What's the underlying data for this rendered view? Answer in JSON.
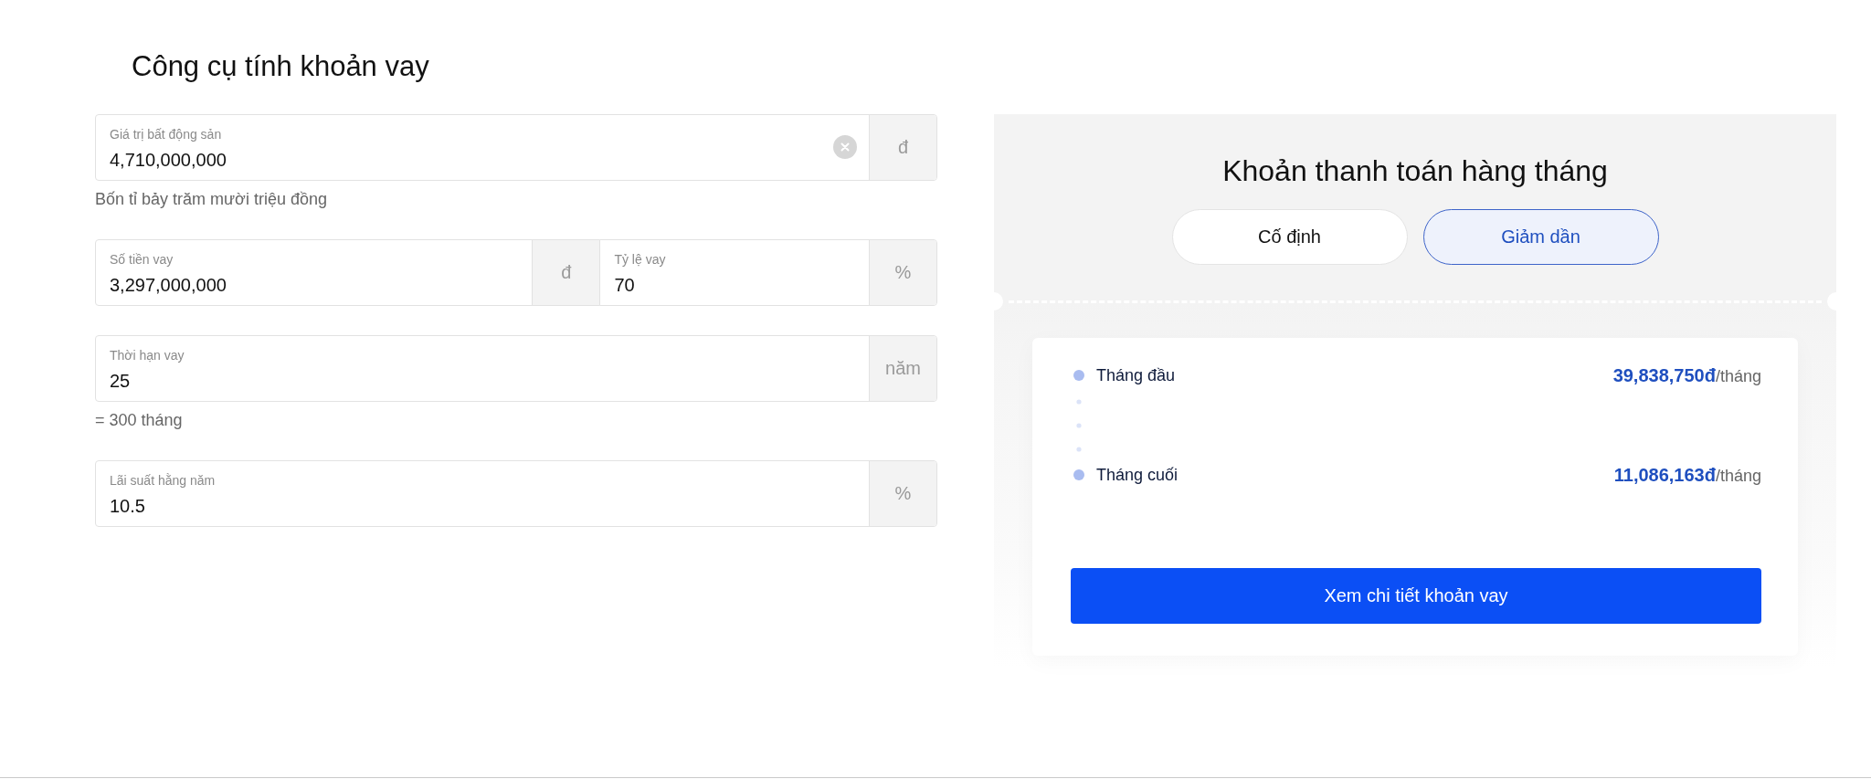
{
  "title": "Công cụ tính khoản vay",
  "form": {
    "groups": [
      {
        "fields": [
          {
            "label": "Giá trị bất động sản",
            "value": "4,710,000,000",
            "clearable": true,
            "unit": "đ"
          }
        ],
        "hint": "Bốn tỉ bảy trăm mười triệu đồng"
      },
      {
        "fields": [
          {
            "label": "Số tiền vay",
            "value": "3,297,000,000",
            "clearable": false,
            "unit": "đ"
          },
          {
            "label": "Tỷ lệ vay",
            "value": "70",
            "clearable": false,
            "unit": "%"
          }
        ]
      },
      {
        "fields": [
          {
            "label": "Thời hạn vay",
            "value": "25",
            "clearable": false,
            "unit": "năm"
          }
        ],
        "hint": "= 300 tháng"
      },
      {
        "fields": [
          {
            "label": "Lãi suất hằng năm",
            "value": "10.5",
            "clearable": false,
            "unit": "%"
          }
        ]
      }
    ]
  },
  "payment": {
    "heading": "Khoản thanh toán hàng tháng",
    "modes": [
      {
        "label": "Cố định",
        "selected": false
      },
      {
        "label": "Giảm dần",
        "selected": true
      }
    ],
    "items": [
      {
        "label": "Tháng đầu",
        "amount": "39,838,750đ",
        "unit": "/tháng"
      },
      {
        "label": "Tháng cuối",
        "amount": "11,086,163đ",
        "unit": "/tháng"
      }
    ],
    "button": "Xem chi tiết khoản vay"
  }
}
